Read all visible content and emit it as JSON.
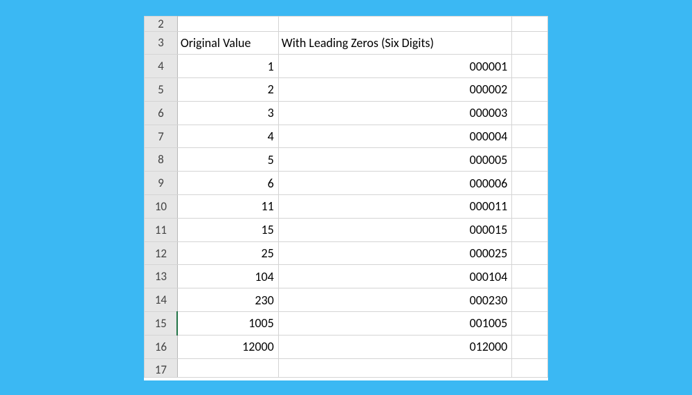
{
  "partial_top_row": "2",
  "header_row": {
    "num": "3",
    "col_a": "Original Value",
    "col_b": "With Leading Zeros (Six Digits)"
  },
  "rows": [
    {
      "num": "4",
      "a": "1",
      "b": "000001"
    },
    {
      "num": "5",
      "a": "2",
      "b": "000002"
    },
    {
      "num": "6",
      "a": "3",
      "b": "000003"
    },
    {
      "num": "7",
      "a": "4",
      "b": "000004"
    },
    {
      "num": "8",
      "a": "5",
      "b": "000005"
    },
    {
      "num": "9",
      "a": "6",
      "b": "000006"
    },
    {
      "num": "10",
      "a": "11",
      "b": "000011"
    },
    {
      "num": "11",
      "a": "15",
      "b": "000015"
    },
    {
      "num": "12",
      "a": "25",
      "b": "000025"
    },
    {
      "num": "13",
      "a": "104",
      "b": "000104"
    },
    {
      "num": "14",
      "a": "230",
      "b": "000230"
    },
    {
      "num": "15",
      "a": "1005",
      "b": "001005",
      "selected": true
    },
    {
      "num": "16",
      "a": "12000",
      "b": "012000"
    }
  ],
  "partial_bottom_row": "17"
}
